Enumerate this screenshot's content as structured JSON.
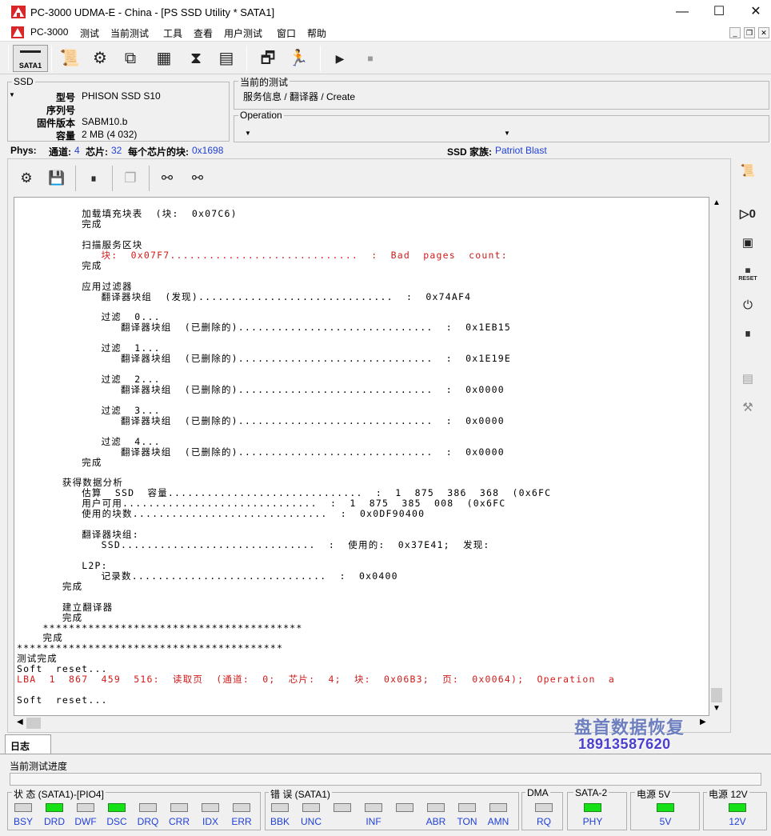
{
  "window": {
    "title": "PC-3000 UDMA-E - China - [PS SSD Utility * SATA1]",
    "minimize": "—",
    "maximize": "☐",
    "close": "✕"
  },
  "menu": {
    "items": [
      "PC-3000",
      "测试",
      "当前测试",
      "工具",
      "查看",
      "用户测试",
      "窗口",
      "帮助"
    ]
  },
  "toolbar": {
    "sata_label": "SATA1"
  },
  "ssd": {
    "group_label": "SSD",
    "model_label": "型号",
    "model_value": "PHISON SSD S10",
    "serial_label": "序列号",
    "serial_value": "",
    "firmware_label": "固件版本",
    "firmware_value": "SABM10.b",
    "capacity_label": "容量",
    "capacity_value": "2 MB (4 032)"
  },
  "current_test": {
    "group_label": "当前的测试",
    "value": "服务信息 / 翻译器 / Create"
  },
  "operation": {
    "group_label": "Operation",
    "value": ""
  },
  "phys": {
    "label": "Phys:",
    "channels_label": "通道:",
    "channels_value": "4",
    "chips_label": "芯片:",
    "chips_value": "32",
    "blocks_label": "每个芯片的块:",
    "blocks_value": "0x1698",
    "family_label": "SSD 家族:",
    "family_value": "Patriot Blast"
  },
  "log": {
    "lines": [
      {
        "text": "          加载填充块表  (块:  0x07C6)",
        "color": "black"
      },
      {
        "text": "          完成",
        "color": "black"
      },
      {
        "text": "",
        "color": "black"
      },
      {
        "text": "          扫描服务区块",
        "color": "black"
      },
      {
        "text": "             块:  0x07F7.............................  :  Bad  pages  count:",
        "color": "red"
      },
      {
        "text": "          完成",
        "color": "black"
      },
      {
        "text": "",
        "color": "black"
      },
      {
        "text": "          应用过滤器",
        "color": "black"
      },
      {
        "text": "             翻译器块组  (发现)..............................  :  0x74AF4",
        "color": "black"
      },
      {
        "text": "",
        "color": "black"
      },
      {
        "text": "             过滤  0...",
        "color": "black"
      },
      {
        "text": "                翻译器块组  (已删除的)..............................  :  0x1EB15",
        "color": "black"
      },
      {
        "text": "",
        "color": "black"
      },
      {
        "text": "             过滤  1...",
        "color": "black"
      },
      {
        "text": "                翻译器块组  (已删除的)..............................  :  0x1E19E",
        "color": "black"
      },
      {
        "text": "",
        "color": "black"
      },
      {
        "text": "             过滤  2...",
        "color": "black"
      },
      {
        "text": "                翻译器块组  (已删除的)..............................  :  0x0000",
        "color": "black"
      },
      {
        "text": "",
        "color": "black"
      },
      {
        "text": "             过滤  3...",
        "color": "black"
      },
      {
        "text": "                翻译器块组  (已删除的)..............................  :  0x0000",
        "color": "black"
      },
      {
        "text": "",
        "color": "black"
      },
      {
        "text": "             过滤  4...",
        "color": "black"
      },
      {
        "text": "                翻译器块组  (已删除的)..............................  :  0x0000",
        "color": "black"
      },
      {
        "text": "          完成",
        "color": "black"
      },
      {
        "text": "",
        "color": "black"
      },
      {
        "text": "       获得数据分析",
        "color": "black"
      },
      {
        "text": "          估算  SSD  容量..............................  :  1  875  386  368  (0x6FC",
        "color": "black"
      },
      {
        "text": "          用户可用..............................  :  1  875  385  008  (0x6FC",
        "color": "black"
      },
      {
        "text": "          使用的块数..............................  :  0x0DF90400",
        "color": "black"
      },
      {
        "text": "",
        "color": "black"
      },
      {
        "text": "          翻译器块组:",
        "color": "black"
      },
      {
        "text": "             SSD..............................  :  使用的:  0x37E41;  发现:",
        "color": "black"
      },
      {
        "text": "",
        "color": "black"
      },
      {
        "text": "          L2P:",
        "color": "black"
      },
      {
        "text": "             记录数..............................  :  0x0400",
        "color": "black"
      },
      {
        "text": "       完成",
        "color": "black"
      },
      {
        "text": "",
        "color": "black"
      },
      {
        "text": "       建立翻译器",
        "color": "black"
      },
      {
        "text": "       完成",
        "color": "black"
      },
      {
        "text": "    ****************************************",
        "color": "black"
      },
      {
        "text": "    完成",
        "color": "black"
      },
      {
        "text": "*****************************************",
        "color": "black"
      },
      {
        "text": "测试完成",
        "color": "black"
      },
      {
        "text": "Soft  reset...",
        "color": "black"
      },
      {
        "text": "LBA  1  867  459  516:  读取页  (通道:  0;  芯片:  4;  块:  0x06B3;  页:  0x0064);  Operation  a",
        "color": "red"
      },
      {
        "text": "",
        "color": "black"
      },
      {
        "text": "Soft  reset...",
        "color": "black"
      }
    ]
  },
  "tabs": {
    "log": "日志"
  },
  "watermark": {
    "line1": "盘首数据恢复",
    "line2": "18913587620"
  },
  "progress": {
    "label": "当前测试进度",
    "value": 0
  },
  "status": {
    "state_label": "状 态 (SATA1)-[PIO4]",
    "state_leds": [
      {
        "name": "BSY",
        "on": false
      },
      {
        "name": "DRD",
        "on": true
      },
      {
        "name": "DWF",
        "on": false
      },
      {
        "name": "DSC",
        "on": true
      },
      {
        "name": "DRQ",
        "on": false
      },
      {
        "name": "CRR",
        "on": false
      },
      {
        "name": "IDX",
        "on": false
      },
      {
        "name": "ERR",
        "on": false
      }
    ],
    "error_label": "错 误 (SATA1)",
    "error_leds": [
      {
        "name": "BBK",
        "on": false
      },
      {
        "name": "UNC",
        "on": false
      },
      {
        "name": "",
        "on": false
      },
      {
        "name": "INF",
        "on": false
      },
      {
        "name": "",
        "on": false
      },
      {
        "name": "ABR",
        "on": false
      },
      {
        "name": "TON",
        "on": false
      },
      {
        "name": "AMN",
        "on": false
      }
    ],
    "dma_label": "DMA",
    "dma_led": {
      "name": "RQ",
      "on": false
    },
    "sata2_label": "SATA-2",
    "sata2_led": {
      "name": "PHY",
      "on": true
    },
    "p5_label": "电源 5V",
    "p5_led": {
      "name": "5V",
      "on": true
    },
    "p12_label": "电源 12V",
    "p12_led": {
      "name": "12V",
      "on": true
    }
  },
  "colors": {
    "accent_blue": "#1f3fd8",
    "log_red": "#d21a1a",
    "led_on": "#16e016"
  }
}
